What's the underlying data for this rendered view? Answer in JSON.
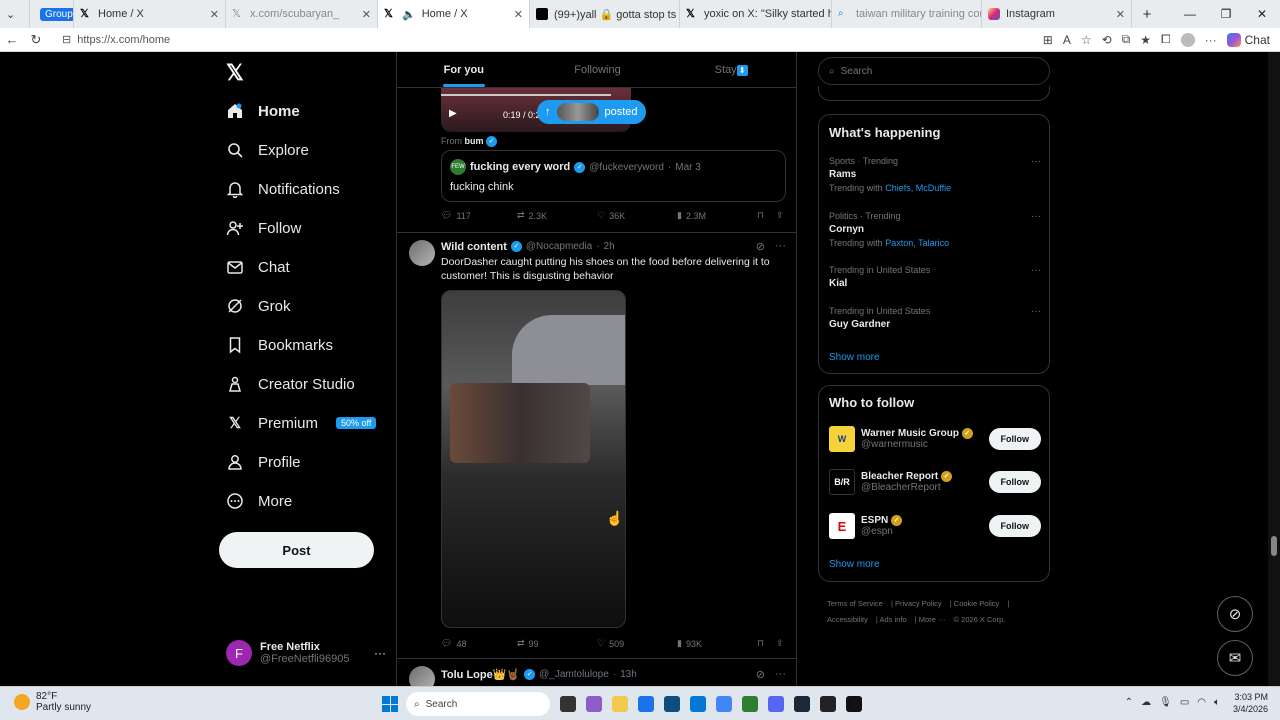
{
  "browser": {
    "tabs": [
      {
        "label": "Group 1",
        "type": "group"
      },
      {
        "label": "Home / X",
        "type": "tab"
      },
      {
        "label": "x.com/scubaryan_",
        "type": "tab"
      },
      {
        "label": "Home / X",
        "type": "tab",
        "active": true
      },
      {
        "label": "(99+)yall 🔒 gotta stop ts 🧭🧭 🧭",
        "type": "tab"
      },
      {
        "label": "yoxic on X: \"Silky started his stre",
        "type": "tab"
      },
      {
        "label": "taiwan military training consist -",
        "type": "tab"
      },
      {
        "label": "Instagram",
        "type": "tab"
      }
    ],
    "url": "https://x.com/home",
    "copilot_label": "Chat"
  },
  "nav": {
    "items": [
      {
        "label": "Home",
        "icon": "home-icon",
        "bold": true
      },
      {
        "label": "Explore",
        "icon": "search-icon"
      },
      {
        "label": "Notifications",
        "icon": "bell-icon"
      },
      {
        "label": "Follow",
        "icon": "add-person-icon"
      },
      {
        "label": "Chat",
        "icon": "mail-icon"
      },
      {
        "label": "Grok",
        "icon": "grok-icon"
      },
      {
        "label": "Bookmarks",
        "icon": "bookmark-icon"
      },
      {
        "label": "Creator Studio",
        "icon": "creator-icon"
      },
      {
        "label": "Premium",
        "icon": "x-icon",
        "badge": "50% off"
      },
      {
        "label": "Profile",
        "icon": "person-icon"
      },
      {
        "label": "More",
        "icon": "more-circle-icon"
      }
    ],
    "post_label": "Post",
    "account": {
      "initial": "F",
      "name": "Free Netflix",
      "handle": "@FreeNetfli96905"
    }
  },
  "feed": {
    "tabs": [
      "For you",
      "Following",
      "Stay"
    ],
    "active_tab": "For you",
    "video_time": "0:19 / 0:2",
    "posted_pill": "posted",
    "from_label": "From",
    "from_name": "bum",
    "quote": {
      "avatar_text": "FEW",
      "name": "fucking every word",
      "handle": "@fuckeveryword",
      "date": "Mar 3",
      "text": "fucking chink"
    },
    "post1_stats": {
      "replies": "117",
      "reposts": "2.3K",
      "likes": "36K",
      "views": "2.3M"
    },
    "post2": {
      "name": "Wild content",
      "handle": "@Nocapmedia",
      "time": "2h",
      "text": "DoorDasher caught putting his shoes on the food before delivering it to customer! This is disgusting behavior",
      "stats": {
        "replies": "48",
        "reposts": "99",
        "likes": "509",
        "views": "93K"
      }
    },
    "post3": {
      "name": "Tolu Lope👑🤘🏾",
      "handle": "@_Jamtolulope",
      "time": "13h"
    }
  },
  "right": {
    "search_placeholder": "Search",
    "happening_title": "What's happening",
    "trends": [
      {
        "category": "Sports · Trending",
        "title": "Rams",
        "with_label": "Trending with",
        "with": "Chiefs, McDuffie"
      },
      {
        "category": "Politics · Trending",
        "title": "Cornyn",
        "with_label": "Trending with",
        "with": "Paxton, Talarico"
      },
      {
        "category": "Trending in United States",
        "title": "Kial",
        "with_label": "",
        "with": ""
      },
      {
        "category": "Trending in United States",
        "title": "Guy Gardner",
        "with_label": "",
        "with": ""
      }
    ],
    "show_more": "Show more",
    "wtf_title": "Who to follow",
    "follow": [
      {
        "name": "Warner Music Group",
        "handle": "@warnermusic",
        "logo": "W",
        "button": "Follow"
      },
      {
        "name": "Bleacher Report",
        "handle": "@BleacherReport",
        "logo": "B/R",
        "button": "Follow"
      },
      {
        "name": "ESPN",
        "handle": "@espn",
        "logo": "E",
        "button": "Follow"
      }
    ],
    "footer": [
      "Terms of Service",
      "Privacy Policy",
      "Cookie Policy",
      "Accessibility",
      "Ads info",
      "More ···",
      "© 2026 X Corp."
    ]
  },
  "taskbar": {
    "weather_temp": "82°F",
    "weather_text": "Partly sunny",
    "search_label": "Search",
    "time": "3:03 PM",
    "date": "3/4/2026"
  },
  "colors": {
    "accent": "#1d9bf0",
    "background": "#000000",
    "border": "#2f3336",
    "muted": "#71767b"
  }
}
